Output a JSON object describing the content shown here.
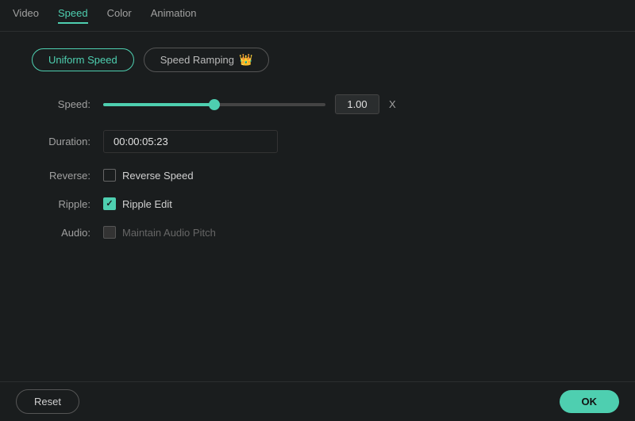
{
  "topNav": {
    "tabs": [
      {
        "id": "video",
        "label": "Video",
        "active": false
      },
      {
        "id": "speed",
        "label": "Speed",
        "active": true
      },
      {
        "id": "color",
        "label": "Color",
        "active": false
      },
      {
        "id": "animation",
        "label": "Animation",
        "active": false
      }
    ]
  },
  "modeButtons": {
    "uniformSpeed": "Uniform Speed",
    "speedRamping": "Speed Ramping"
  },
  "speed": {
    "label": "Speed:",
    "value": "1.00",
    "unit": "X",
    "sliderPercent": 50
  },
  "duration": {
    "label": "Duration:",
    "value": "00:00:05:23"
  },
  "reverse": {
    "label": "Reverse:",
    "checkboxLabel": "Reverse Speed",
    "checked": false
  },
  "ripple": {
    "label": "Ripple:",
    "checkboxLabel": "Ripple Edit",
    "checked": true
  },
  "audio": {
    "label": "Audio:",
    "checkboxLabel": "Maintain Audio Pitch",
    "checked": false,
    "disabled": true
  },
  "footer": {
    "resetLabel": "Reset",
    "okLabel": "OK"
  },
  "icons": {
    "crown": "👑",
    "checkmark": "✓"
  }
}
